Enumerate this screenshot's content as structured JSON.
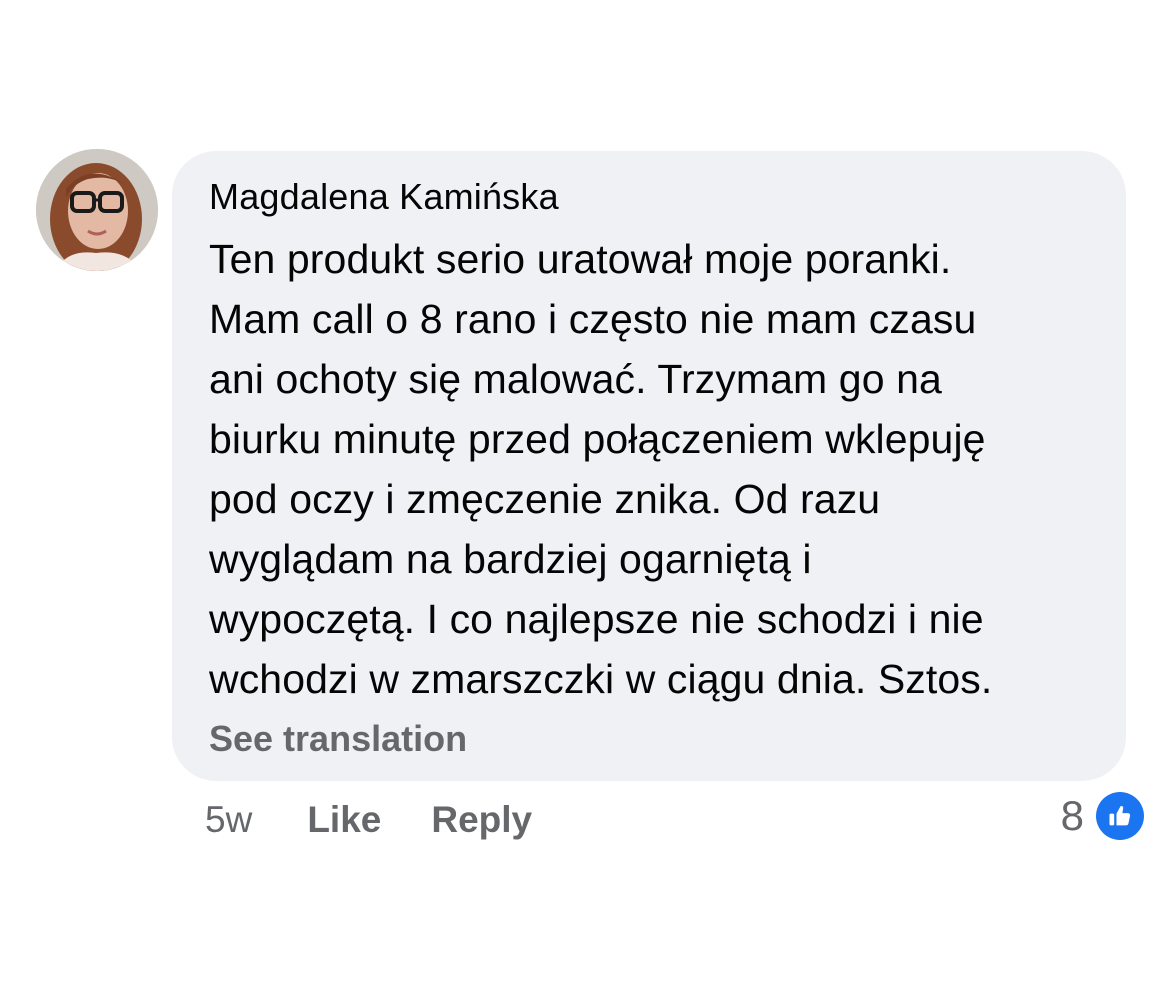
{
  "comment": {
    "author": "Magdalena Kamińska",
    "text": "Ten produkt serio uratował moje poranki.\nMam call o 8 rano i często nie mam czasu\nani ochoty się malować. Trzymam go na\nbiurku minutę przed połączeniem wklepuję\npod oczy i zmęczenie znika. Od razu\nwyglądam na bardziej ogarniętą i\nwypoczętą. I co najlepsze nie schodzi i nie\nwchodzi w zmarszczki w ciągu dnia. Sztos.",
    "see_translation_label": "See translation"
  },
  "actions": {
    "time": "5w",
    "like_label": "Like",
    "reply_label": "Reply"
  },
  "reactions": {
    "count": "8",
    "icon": "thumbs-up-icon",
    "badge_color": "#1b74f0"
  },
  "colors": {
    "bubble_bg": "#f0f1f5",
    "text_primary": "#050505",
    "text_secondary": "#65676b"
  }
}
